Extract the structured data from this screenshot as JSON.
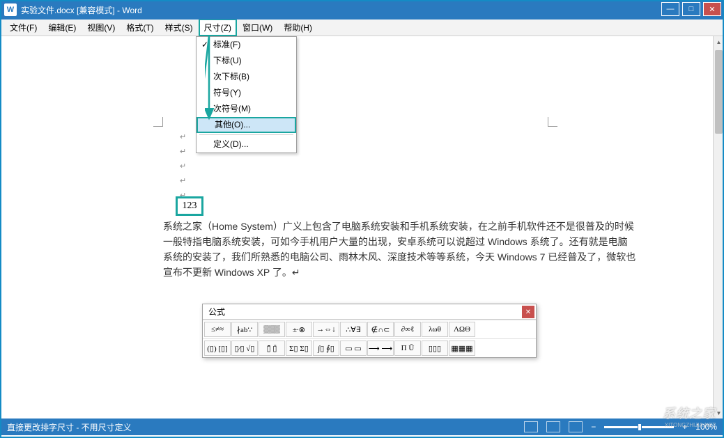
{
  "window": {
    "app_icon_text": "W",
    "title": "实验文件.docx [兼容模式] - Word",
    "minimize": "—",
    "maximize": "□",
    "close": "✕"
  },
  "menubar": [
    {
      "label": "文件(F)"
    },
    {
      "label": "编辑(E)"
    },
    {
      "label": "视图(V)"
    },
    {
      "label": "格式(T)"
    },
    {
      "label": "样式(S)"
    },
    {
      "label": "尺寸(Z)",
      "active": true
    },
    {
      "label": "窗口(W)"
    },
    {
      "label": "帮助(H)"
    }
  ],
  "dropdown": {
    "items": [
      {
        "label": "标准(F)",
        "checked": true
      },
      {
        "label": "下标(U)"
      },
      {
        "label": "次下标(B)"
      },
      {
        "label": "符号(Y)"
      },
      {
        "label": "次符号(M)"
      },
      {
        "label": "其他(O)...",
        "highlighted": true
      },
      {
        "sep": true
      },
      {
        "label": "定义(D)..."
      }
    ]
  },
  "equation_box": "123",
  "document_text": "系统之家（Home System）广义上包含了电脑系统安装和手机系统安装，在之前手机软件还不是很普及的时候一般特指电脑系统安装，可如今手机用户大量的出现，安卓系统可以说超过 Windows 系统了。还有就是电脑系统的安装了，我们所熟悉的电脑公司、雨林木风、深度技术等等系统，今天 Windows 7 已经普及了，微软也宣布不更新 Windows XP 了。↵",
  "equation_toolbar": {
    "title": "公式",
    "close": "✕",
    "row1": [
      "≤≠≈",
      "∤ab∵",
      "▒▒▒",
      "±∙⊗",
      "→⇔↓",
      "∴∀∃",
      "∉∩⊂",
      "∂∞ℓ",
      "λωθ",
      "ΛΩΘ"
    ],
    "row2": [
      "(▯) [▯]",
      "▯⁄▯ √▯",
      "▯̄ ▯̈",
      "Σ▯ Σ▯",
      "∫▯ ∮▯",
      "▭ ▭",
      "⟶ ⟶",
      "Π Ū",
      "▯▯▯",
      "▦▦▦"
    ]
  },
  "statusbar": {
    "left": "直接更改排字尺寸 - 不用尺寸定义",
    "zoom_minus": "−",
    "zoom_plus": "+",
    "zoom_value": "100%"
  },
  "watermark": {
    "main": "系统之家",
    "sub": "XITONGZHIJIA.NET"
  }
}
